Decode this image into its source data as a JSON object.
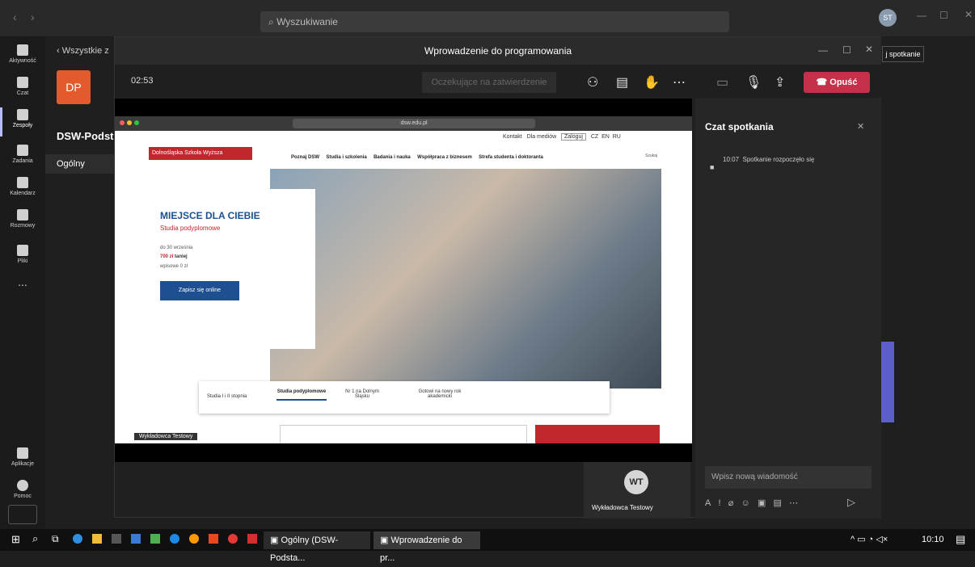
{
  "os": {
    "search_placeholder": "Wyszukiwanie",
    "avatar_initials": "ST",
    "time": "10:10"
  },
  "rail": [
    {
      "label": "Aktywność"
    },
    {
      "label": "Czat"
    },
    {
      "label": "Zespoły"
    },
    {
      "label": "Zadania"
    },
    {
      "label": "Kalendarz"
    },
    {
      "label": "Rozmowy"
    },
    {
      "label": "Pliki"
    },
    {
      "label": "..."
    }
  ],
  "rail_bottom": [
    {
      "label": "Aplikacje"
    },
    {
      "label": "Pomoc"
    }
  ],
  "teams": {
    "back_label": "Wszystkie z",
    "team_initials": "DP",
    "team_name": "DSW-Podst",
    "channel": "Ogólny"
  },
  "right_behind": {
    "meeting_btn": "j spotkanie"
  },
  "meeting": {
    "title": "Wprowadzenie do programowania",
    "timer": "02:53",
    "pending_label": "Oczekujące na zatwierdzenie",
    "leave_label": "Opuść"
  },
  "website": {
    "url": "dsw.edu.pl",
    "top_links": [
      "Kontakt",
      "Dla mediów",
      "Zaloguj",
      "CZ",
      "EN",
      "RU"
    ],
    "logo_text": "Dolnośląska Szkoła Wyższa",
    "nav": [
      "Poznaj DSW",
      "Studia i szkolenia",
      "Badania i nauka",
      "Współpraca z biznesem",
      "Strefa studenta i doktoranta"
    ],
    "search_label": "Szukaj",
    "hero_title": "MIEJSCE DLA CIEBIE",
    "hero_sub": "Studia podyplomowe",
    "hero_line1": "do 30 września",
    "hero_line2a": "700 zł",
    "hero_line2b": "taniej",
    "hero_line3": "wpisowe 0 zł",
    "hero_button": "Zapisz się online",
    "tabs": [
      "Studia I i II stopnia",
      "Studia podyplomowe",
      "Nr 1 na Dolnym Śląsku",
      "Gotowi na nowy rok akademicki"
    ],
    "presenter_label": "Wykładowca Testowy"
  },
  "chat": {
    "title": "Czat spotkania",
    "msg_time": "10:07",
    "msg_text": "Spotkanie rozpoczęło się",
    "input_placeholder": "Wpisz nową wiadomość"
  },
  "participant": {
    "initials": "WT",
    "name": "Wykładowca Testowy"
  },
  "taskbar": {
    "tab1": "Ogólny (DSW-Podsta...",
    "tab2": "Wprowadzenie do pr..."
  },
  "colors": {
    "accent": "#6264a7",
    "leave": "#c4314b",
    "team_tile": "#e35b2c",
    "dsw_red": "#c0272d",
    "dsw_blue": "#1d4f91"
  }
}
